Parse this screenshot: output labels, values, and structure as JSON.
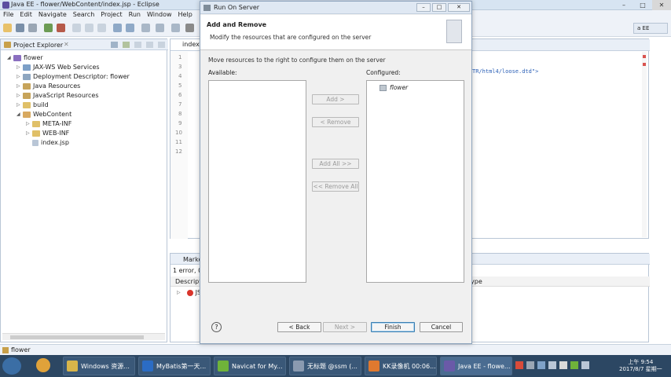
{
  "window": {
    "title": "Java EE - flower/WebContent/index.jsp - Eclipse",
    "menu": [
      "File",
      "Edit",
      "Navigate",
      "Search",
      "Project",
      "Run",
      "Window",
      "Help"
    ],
    "quick_access": "a EE"
  },
  "project_explorer": {
    "title": "Project Explorer",
    "items": [
      {
        "label": "flower",
        "level": 0
      },
      {
        "label": "JAX-WS Web Services",
        "level": 1
      },
      {
        "label": "Deployment Descriptor: flower",
        "level": 1
      },
      {
        "label": "Java Resources",
        "level": 1
      },
      {
        "label": "JavaScript Resources",
        "level": 1
      },
      {
        "label": "build",
        "level": 1
      },
      {
        "label": "WebContent",
        "level": 1
      },
      {
        "label": "META-INF",
        "level": 2
      },
      {
        "label": "WEB-INF",
        "level": 2
      },
      {
        "label": "index.jsp",
        "level": 2
      }
    ]
  },
  "editor": {
    "tab": "index",
    "line_numbers": [
      "1",
      "3",
      "4",
      "5",
      "6",
      "7",
      "8",
      "9",
      "10",
      "11",
      "12"
    ],
    "code_fragment": "TR/html4/loose.dtd\">"
  },
  "markers": {
    "tab": "Marke",
    "summary": "1 error, 0",
    "col_description": "Descript",
    "col_type": "ype",
    "row": "JS"
  },
  "status": {
    "selection": "flower"
  },
  "dialog": {
    "title": "Run On Server",
    "heading": "Add and Remove",
    "subheading": "Modify the resources that are configured on the server",
    "description": "Move resources to the right to configure them on the server",
    "available_label": "Available:",
    "configured_label": "Configured:",
    "configured_items": [
      "flower"
    ],
    "buttons": {
      "add": "Add >",
      "remove": "< Remove",
      "add_all": "Add All >>",
      "remove_all": "<< Remove All",
      "back": "< Back",
      "next": "Next >",
      "finish": "Finish",
      "cancel": "Cancel",
      "help": "?"
    }
  },
  "taskbar": {
    "apps": [
      {
        "label": "Windows 资源...",
        "color": "#d8b54a"
      },
      {
        "label": "MyBatis第一天...",
        "color": "#2b6cc4"
      },
      {
        "label": "Navicat for My...",
        "color": "#6fb33a"
      },
      {
        "label": "无标题 @ssm (...",
        "color": "#8a9ab0"
      },
      {
        "label": "KK录像机 00:06...",
        "color": "#e0792f"
      },
      {
        "label": "Java EE - flowe...",
        "color": "#6a5aa8"
      }
    ],
    "time": "上午 9:54",
    "date": "2017/8/7 星期一"
  },
  "colors": {
    "taskbar": "#2c4763",
    "dialog_bg": "#f0f0f0",
    "default_button_border": "#3c7fb1"
  }
}
